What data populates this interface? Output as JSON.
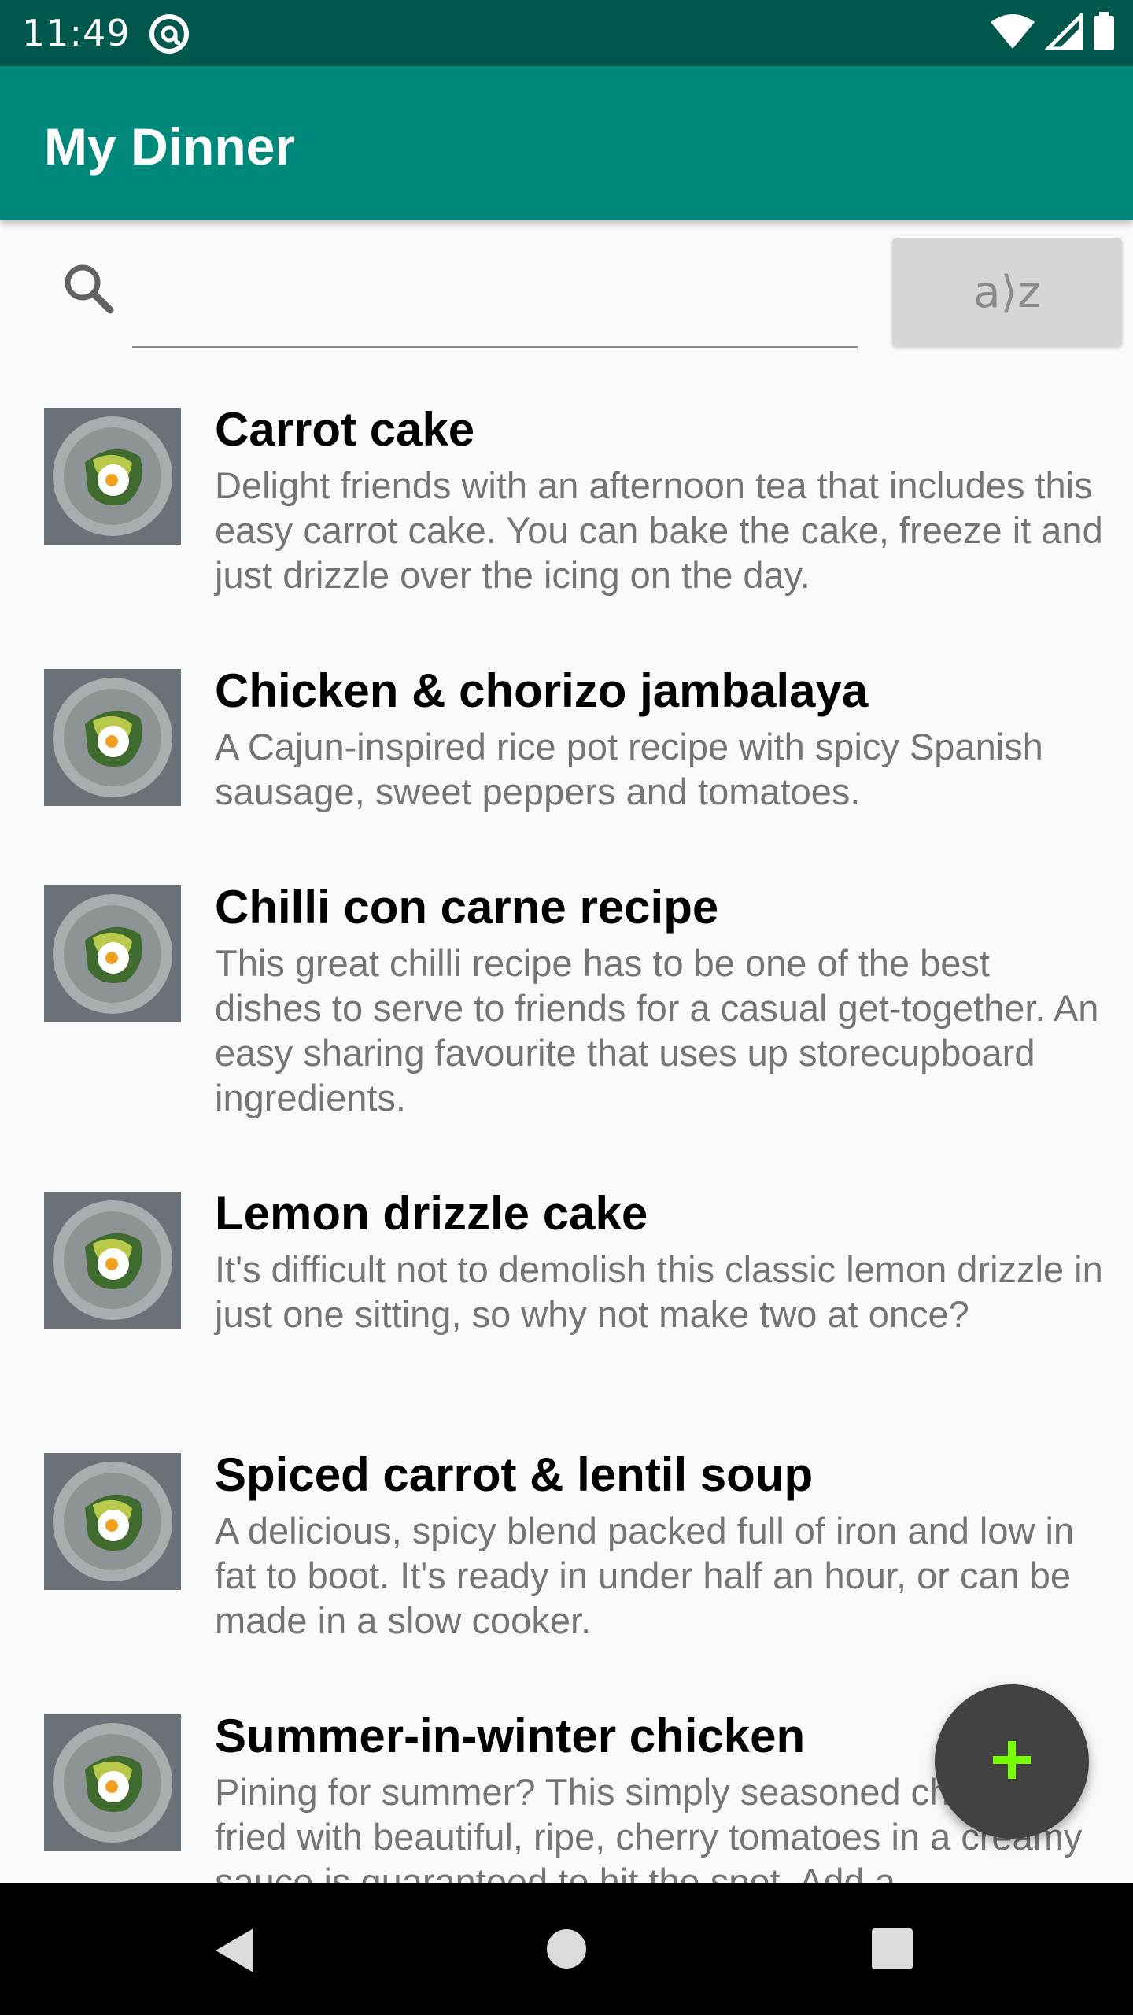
{
  "status_bar": {
    "time": "11:49",
    "icons": [
      "notification-at-icon",
      "wifi-icon",
      "signal-icon",
      "battery-icon"
    ]
  },
  "app_bar": {
    "title": "My Dinner",
    "color": "#00897B"
  },
  "search": {
    "placeholder": "",
    "value": ""
  },
  "sort_button": {
    "label": "a⟩z"
  },
  "recipes": [
    {
      "title": "Carrot cake",
      "description": "Delight friends with an afternoon tea that includes this easy carrot cake. You can bake the cake, freeze it and just drizzle over the icing on the day."
    },
    {
      "title": "Chicken & chorizo jambalaya",
      "description": "A Cajun-inspired rice pot recipe with spicy Spanish sausage, sweet peppers and tomatoes."
    },
    {
      "title": "Chilli con carne recipe",
      "description": "This great chilli recipe has to be one of the best dishes to serve to friends for a casual get-together. An easy sharing favourite that uses up storecupboard ingredients."
    },
    {
      "title": "Lemon drizzle cake",
      "description": "It's difficult not to demolish this classic lemon drizzle in just one sitting, so why not make two at once?"
    },
    {
      "title": "Spiced carrot & lentil soup",
      "description": "A delicious, spicy blend packed full of iron and low in fat to boot. It's ready in under half an hour, or can be made in a slow cooker."
    },
    {
      "title": "Summer-in-winter chicken",
      "description": "Pining for summer? This simply seasoned chicken is fried with beautiful, ripe, cherry tomatoes in a creamy sauce is guaranteed to hit the spot. Add a"
    }
  ],
  "fab": {
    "icon": "plus-icon",
    "icon_color": "#76FF03"
  },
  "nav_bar": {
    "icons": [
      "back-icon",
      "home-icon",
      "recents-icon"
    ]
  }
}
